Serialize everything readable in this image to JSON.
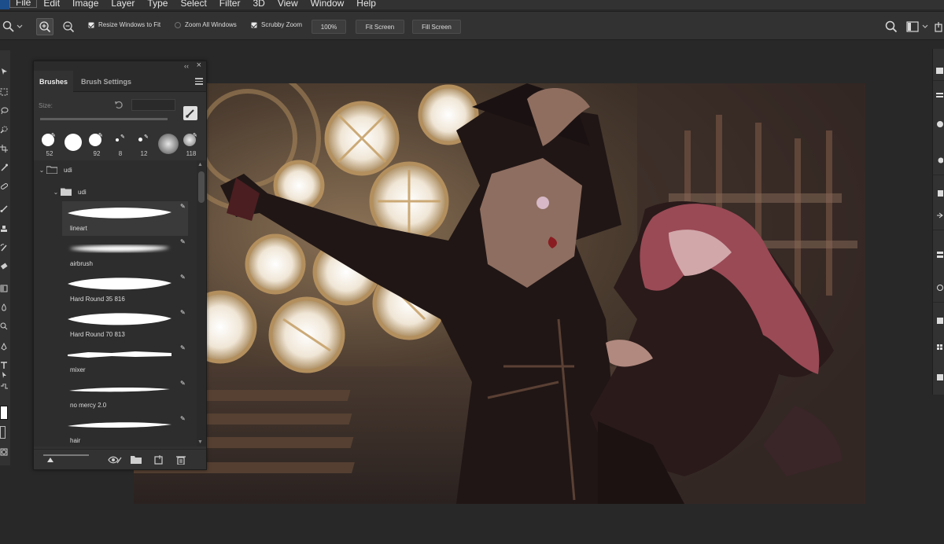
{
  "menubar": {
    "items": [
      "File",
      "Edit",
      "Image",
      "Layer",
      "Type",
      "Select",
      "Filter",
      "3D",
      "View",
      "Window",
      "Help"
    ]
  },
  "options": {
    "tool_icon": "zoom-tool-icon",
    "resize_windows_label": "Resize Windows to Fit",
    "resize_windows_checked": true,
    "zoom_all_label": "Zoom All Windows",
    "zoom_all_checked": false,
    "scrubby_label": "Scrubby Zoom",
    "scrubby_checked": true,
    "zoom_value": "100%",
    "fit_screen_label": "Fit Screen",
    "fill_screen_label": "Fill Screen"
  },
  "brushes_panel": {
    "tabs": [
      "Brushes",
      "Brush Settings"
    ],
    "active_tab": "Brushes",
    "size_label": "Size:",
    "presets": [
      "52",
      "",
      "92",
      "8",
      "12",
      "",
      "118"
    ],
    "folder": "udi",
    "subfolder": "udi",
    "brushes": [
      {
        "name": "lineart"
      },
      {
        "name": "airbrush"
      },
      {
        "name": "Hard Round 35 816"
      },
      {
        "name": "Hard Round 70 813"
      },
      {
        "name": "mixer"
      },
      {
        "name": "no mercy 2.0"
      },
      {
        "name": "hair"
      }
    ]
  },
  "colors": {
    "accent": "#1b4e8a",
    "ui_bg": "#323232",
    "canvas_bg": "#282828"
  }
}
